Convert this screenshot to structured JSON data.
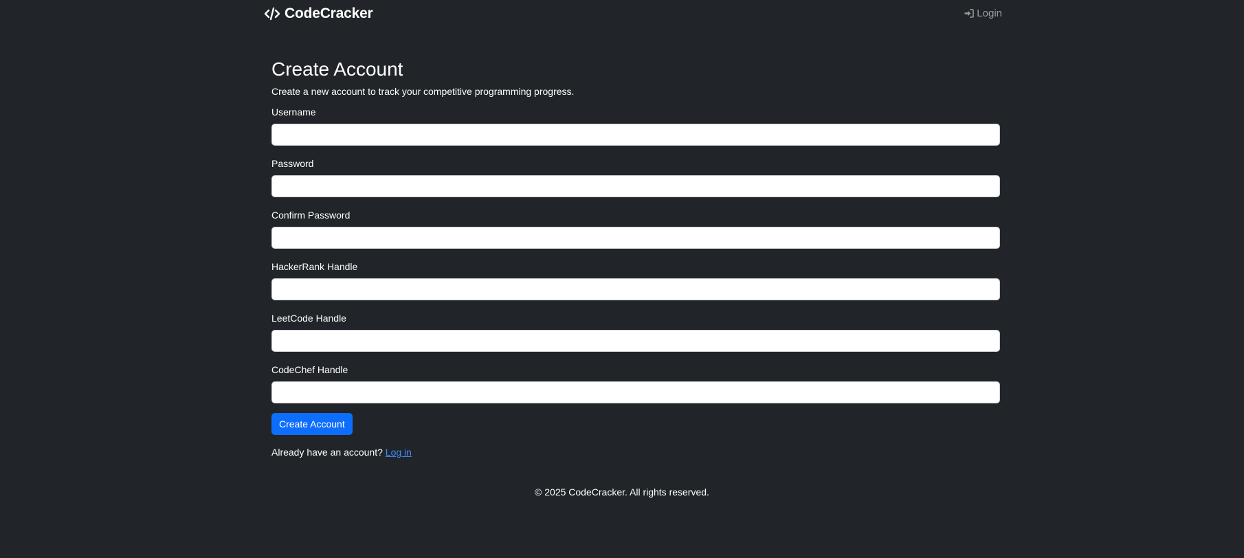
{
  "navbar": {
    "brand_name": "CodeCracker",
    "brand_icon": "code-icon",
    "login_icon": "sign-in-icon",
    "login_label": "Login"
  },
  "form": {
    "title": "Create Account",
    "subtitle": "Create a new account to track your competitive programming progress.",
    "fields": [
      {
        "label": "Username",
        "value": ""
      },
      {
        "label": "Password",
        "value": ""
      },
      {
        "label": "Confirm Password",
        "value": ""
      },
      {
        "label": "HackerRank Handle",
        "value": ""
      },
      {
        "label": "LeetCode Handle",
        "value": ""
      },
      {
        "label": "CodeChef Handle",
        "value": ""
      }
    ],
    "submit_label": "Create Account",
    "login_prompt": "Already have an account?",
    "login_link": "Log in"
  },
  "footer": {
    "copyright": "© 2025 CodeCracker. All rights reserved."
  },
  "colors": {
    "background": "#212529",
    "primary": "#0d6efd",
    "link": "#3d8bfd",
    "muted_nav": "rgba(255,255,255,0.55)"
  }
}
